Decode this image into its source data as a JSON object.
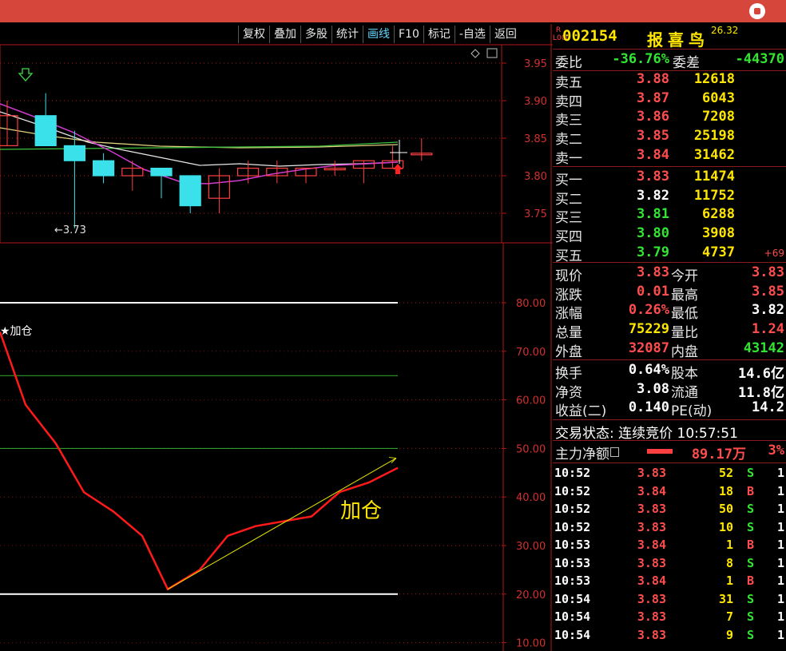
{
  "toolbar": {
    "tabs": [
      "复权",
      "叠加",
      "多股",
      "统计",
      "画线",
      "F10",
      "标记",
      "-自选",
      "返回"
    ],
    "active": "画线"
  },
  "price_chart": {
    "y_ticks": [
      "3.95",
      "3.90",
      "3.85",
      "3.80",
      "3.75"
    ],
    "low_marker": "3.73",
    "candles": [
      {
        "o": 3.84,
        "h": 3.9,
        "l": 3.84,
        "c": 3.88
      },
      {
        "o": 3.88,
        "h": 3.91,
        "l": 3.84,
        "c": 3.84
      },
      {
        "o": 3.84,
        "h": 3.86,
        "l": 3.73,
        "c": 3.82
      },
      {
        "o": 3.82,
        "h": 3.83,
        "l": 3.79,
        "c": 3.8
      },
      {
        "o": 3.8,
        "h": 3.82,
        "l": 3.78,
        "c": 3.81
      },
      {
        "o": 3.81,
        "h": 3.81,
        "l": 3.77,
        "c": 3.8
      },
      {
        "o": 3.8,
        "h": 3.8,
        "l": 3.75,
        "c": 3.76
      },
      {
        "o": 3.77,
        "h": 3.81,
        "l": 3.75,
        "c": 3.8
      },
      {
        "o": 3.8,
        "h": 3.82,
        "l": 3.79,
        "c": 3.81
      },
      {
        "o": 3.8,
        "h": 3.82,
        "l": 3.79,
        "c": 3.81
      },
      {
        "o": 3.8,
        "h": 3.81,
        "l": 3.79,
        "c": 3.81
      },
      {
        "o": 3.81,
        "h": 3.82,
        "l": 3.8,
        "c": 3.81
      },
      {
        "o": 3.81,
        "h": 3.82,
        "l": 3.79,
        "c": 3.82
      },
      {
        "o": 3.81,
        "h": 3.84,
        "l": 3.81,
        "c": 3.82
      },
      {
        "o": 3.83,
        "h": 3.85,
        "l": 3.82,
        "c": 3.83
      }
    ]
  },
  "indicator": {
    "y_ticks": [
      "80.00",
      "70.00",
      "60.00",
      "50.00",
      "40.00",
      "30.00",
      "20.00",
      "10.00"
    ],
    "marker_text": "★加仓",
    "annotation": "加仓",
    "values": [
      74,
      59,
      51,
      41,
      37,
      32,
      21,
      25,
      32,
      34,
      35,
      36,
      41,
      43,
      46
    ]
  },
  "quote": {
    "badge": "R\nL000",
    "code": "002154",
    "name": "报喜鸟",
    "sup": "26.32",
    "weibi_label": "委比",
    "weibi": "-36.76%",
    "weicha_label": "委差",
    "weicha": "-44370",
    "asks": [
      {
        "label": "卖五",
        "price": "3.88",
        "vol": "12618"
      },
      {
        "label": "卖四",
        "price": "3.87",
        "vol": "6043"
      },
      {
        "label": "卖三",
        "price": "3.86",
        "vol": "7208"
      },
      {
        "label": "卖二",
        "price": "3.85",
        "vol": "25198"
      },
      {
        "label": "卖一",
        "price": "3.84",
        "vol": "31462"
      }
    ],
    "bids": [
      {
        "label": "买一",
        "price": "3.83",
        "vol": "11474",
        "chg": ""
      },
      {
        "label": "买二",
        "price": "3.82",
        "vol": "11752",
        "chg": ""
      },
      {
        "label": "买三",
        "price": "3.81",
        "vol": "6288",
        "chg": ""
      },
      {
        "label": "买四",
        "price": "3.80",
        "vol": "3908",
        "chg": ""
      },
      {
        "label": "买五",
        "price": "3.79",
        "vol": "4737",
        "chg": "+69"
      }
    ],
    "stats": [
      {
        "l1": "现价",
        "v1": "3.83",
        "l2": "今开",
        "v2": "3.83"
      },
      {
        "l1": "涨跌",
        "v1": "0.01",
        "l2": "最高",
        "v2": "3.85"
      },
      {
        "l1": "涨幅",
        "v1": "0.26%",
        "l2": "最低",
        "v2": "3.82"
      },
      {
        "l1": "总量",
        "v1": "75229",
        "l2": "量比",
        "v2": "1.24"
      },
      {
        "l1": "外盘",
        "v1": "32087",
        "l2": "内盘",
        "v2": "43142"
      }
    ],
    "stats2": [
      {
        "l1": "换手",
        "v1": "0.64%",
        "l2": "股本",
        "v2": "14.6亿"
      },
      {
        "l1": "净资",
        "v1": "3.08",
        "l2": "流通",
        "v2": "11.8亿"
      },
      {
        "l1": "收益(二)",
        "v1": "0.140",
        "l2": "PE(动)",
        "v2": "14.2"
      }
    ],
    "status": "交易状态: 连续竞价 10:57:51",
    "main_net_label": "主力净额",
    "main_net": "89.17万",
    "main_net_pct": "3%",
    "trades": [
      {
        "t": "10:52",
        "p": "3.83",
        "v": "52",
        "s": "S",
        "n": "1"
      },
      {
        "t": "10:52",
        "p": "3.84",
        "v": "18",
        "s": "B",
        "n": "1"
      },
      {
        "t": "10:52",
        "p": "3.83",
        "v": "50",
        "s": "S",
        "n": "1"
      },
      {
        "t": "10:52",
        "p": "3.83",
        "v": "10",
        "s": "S",
        "n": "1"
      },
      {
        "t": "10:53",
        "p": "3.84",
        "v": "1",
        "s": "B",
        "n": "1"
      },
      {
        "t": "10:53",
        "p": "3.83",
        "v": "8",
        "s": "S",
        "n": "1"
      },
      {
        "t": "10:53",
        "p": "3.84",
        "v": "1",
        "s": "B",
        "n": "1"
      },
      {
        "t": "10:54",
        "p": "3.83",
        "v": "31",
        "s": "S",
        "n": "1"
      },
      {
        "t": "10:54",
        "p": "3.83",
        "v": "7",
        "s": "S",
        "n": "1"
      },
      {
        "t": "10:54",
        "p": "3.83",
        "v": "9",
        "s": "S",
        "n": "1"
      }
    ]
  }
}
